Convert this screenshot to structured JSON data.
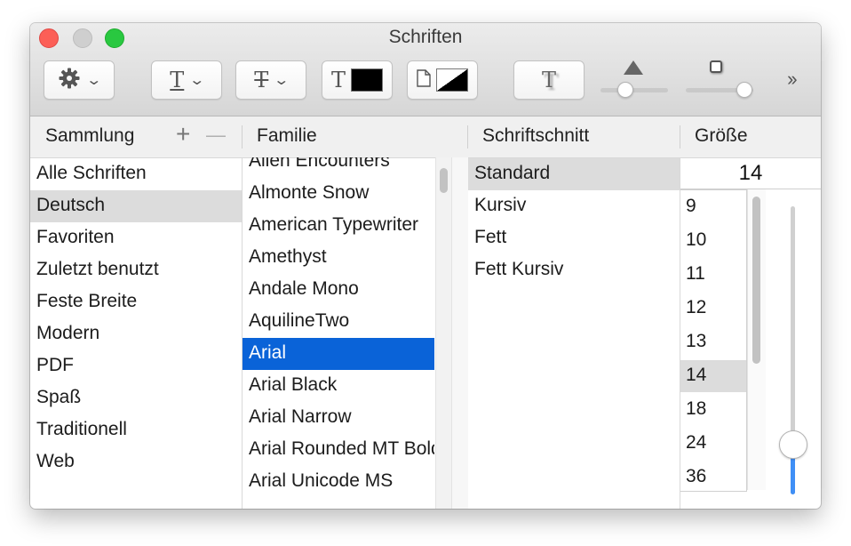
{
  "window": {
    "title": "Schriften"
  },
  "toolbar": {
    "actions_icon": "gear-icon",
    "chevron_icon": "chevron-down-icon",
    "underline_glyph": "T",
    "strikethrough_glyph": "T",
    "text_color_glyph": "T",
    "text_color": "#000000",
    "document_color_icon": "document-icon",
    "shadow_glyph": "T",
    "overflow_label": "››"
  },
  "headers": {
    "collection": "Sammlung",
    "add": "+",
    "remove": "—",
    "family": "Familie",
    "typeface": "Schriftschnitt",
    "size": "Größe"
  },
  "collections": [
    {
      "label": "Alle Schriften",
      "selected": false
    },
    {
      "label": "Deutsch",
      "selected": true
    },
    {
      "label": "Favoriten",
      "selected": false
    },
    {
      "label": "Zuletzt benutzt",
      "selected": false
    },
    {
      "label": "Feste Breite",
      "selected": false
    },
    {
      "label": "Modern",
      "selected": false
    },
    {
      "label": "PDF",
      "selected": false
    },
    {
      "label": "Spaß",
      "selected": false
    },
    {
      "label": "Traditionell",
      "selected": false
    },
    {
      "label": "Web",
      "selected": false
    }
  ],
  "families": [
    {
      "label": "Alien Encounters",
      "selected": false
    },
    {
      "label": "Almonte Snow",
      "selected": false
    },
    {
      "label": "American Typewriter",
      "selected": false
    },
    {
      "label": "Amethyst",
      "selected": false
    },
    {
      "label": "Andale Mono",
      "selected": false
    },
    {
      "label": "AquilineTwo",
      "selected": false
    },
    {
      "label": "Arial",
      "selected": true
    },
    {
      "label": "Arial Black",
      "selected": false
    },
    {
      "label": "Arial Narrow",
      "selected": false
    },
    {
      "label": "Arial Rounded MT Bold",
      "selected": false
    },
    {
      "label": "Arial Unicode MS",
      "selected": false
    }
  ],
  "typefaces": [
    {
      "label": "Standard",
      "selected": true
    },
    {
      "label": "Kursiv",
      "selected": false
    },
    {
      "label": "Fett",
      "selected": false
    },
    {
      "label": "Fett Kursiv",
      "selected": false
    }
  ],
  "size": {
    "value": "14",
    "options": [
      {
        "label": "9",
        "selected": false
      },
      {
        "label": "10",
        "selected": false
      },
      {
        "label": "11",
        "selected": false
      },
      {
        "label": "12",
        "selected": false
      },
      {
        "label": "13",
        "selected": false
      },
      {
        "label": "14",
        "selected": true
      },
      {
        "label": "18",
        "selected": false
      },
      {
        "label": "24",
        "selected": false
      },
      {
        "label": "36",
        "selected": false
      }
    ]
  },
  "colors": {
    "selection_active": "#0a63d8",
    "selection_inactive": "#dcdcdc",
    "slider_fill": "#3f8ff6"
  }
}
